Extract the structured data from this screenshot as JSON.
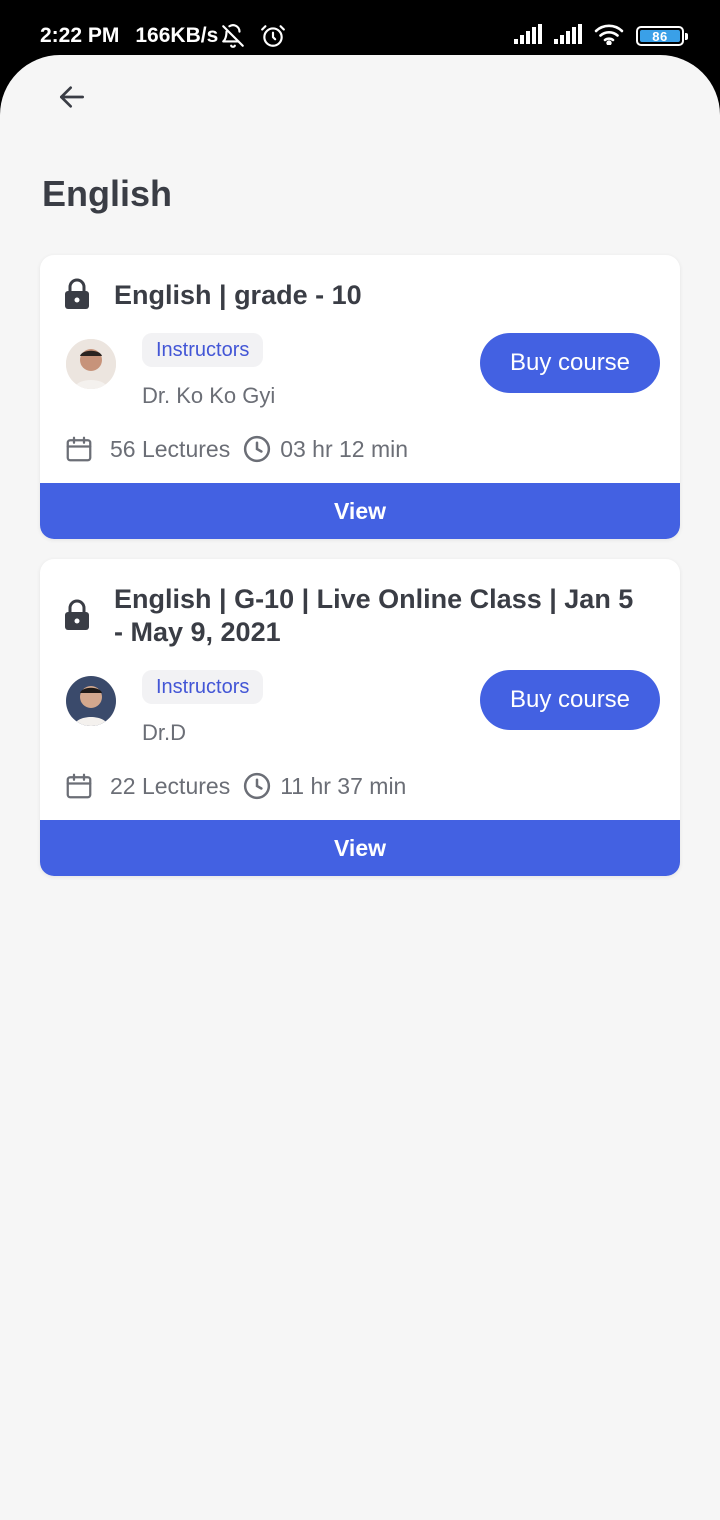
{
  "status_bar": {
    "time": "2:22 PM",
    "speed": "166KB/s",
    "battery_level": "86",
    "icons": [
      "bell-off-icon",
      "alarm-icon",
      "signal-icon",
      "signal-icon",
      "wifi-icon",
      "battery-icon"
    ]
  },
  "header": {
    "back_icon": "arrow-left-icon",
    "title": "English"
  },
  "courses": [
    {
      "title": "English | grade - 10",
      "badge": "Instructors",
      "instructor": "Dr. Ko Ko Gyi",
      "buy_label": "Buy course",
      "lectures": "56 Lectures",
      "duration": "03 hr 12 min",
      "view_label": "View"
    },
    {
      "title": "English | G-10 | Live Online Class | Jan 5 - May 9, 2021",
      "badge": "Instructors",
      "instructor": "Dr.D",
      "buy_label": "Buy course",
      "lectures": "22 Lectures",
      "duration": "11 hr 37 min",
      "view_label": "View"
    }
  ],
  "colors": {
    "accent": "#4361e2",
    "badge_text": "#4356d6",
    "title_text": "#3a3d45",
    "muted_text": "#6b6e76",
    "background": "#f6f6f6"
  }
}
